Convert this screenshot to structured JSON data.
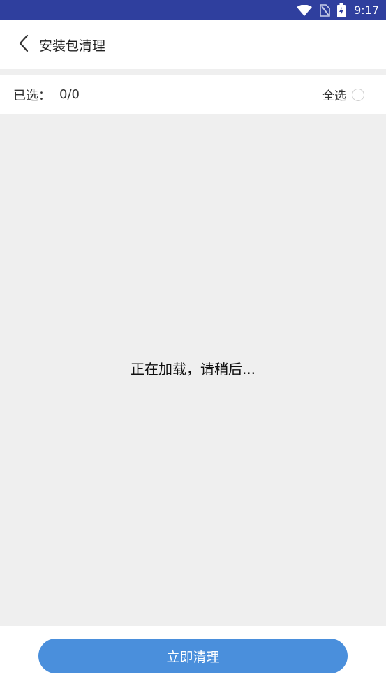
{
  "status_bar": {
    "time": "9:17",
    "icons": [
      "wifi-icon",
      "no-sim-icon",
      "battery-charging-icon"
    ]
  },
  "header": {
    "back_icon": "chevron-left-icon",
    "title": "安装包清理"
  },
  "selection": {
    "label": "已选：",
    "count": "0/0",
    "select_all_label": "全选",
    "select_all_checked": false
  },
  "content": {
    "loading_text": "正在加载，请稍后..."
  },
  "footer": {
    "action_label": "立即清理"
  },
  "colors": {
    "status_bar": "#2f3f9e",
    "accent": "#4a8fdc",
    "background": "#efefef"
  }
}
